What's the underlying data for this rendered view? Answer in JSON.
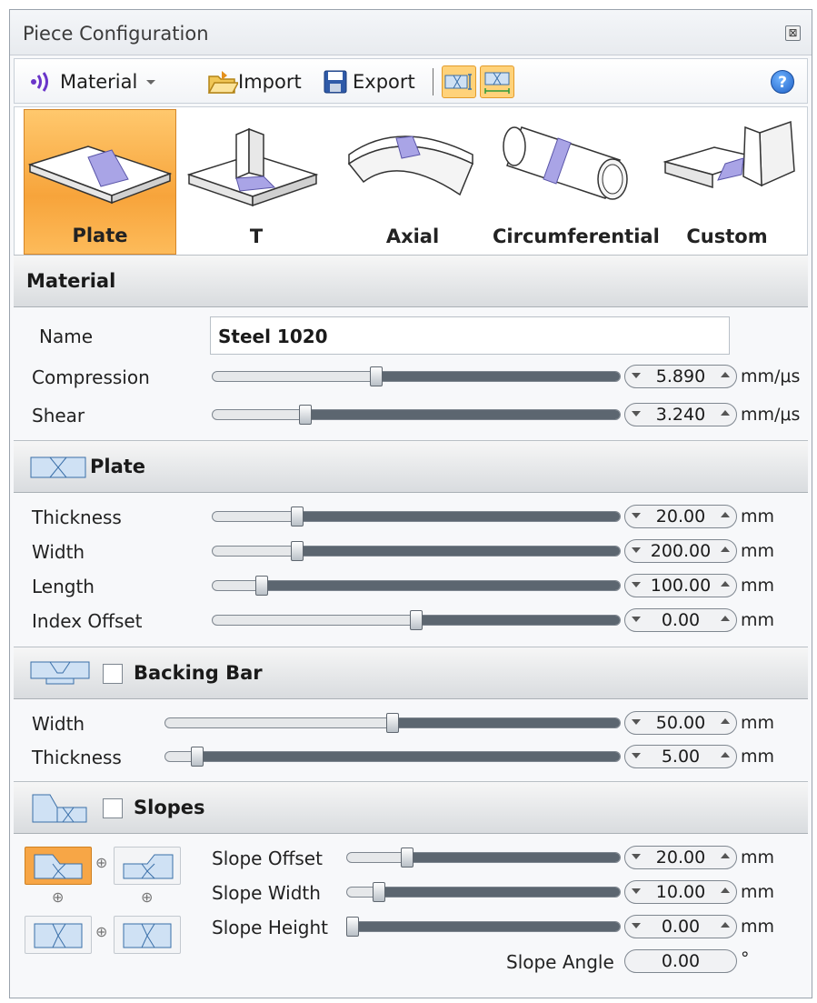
{
  "window": {
    "title": "Piece Configuration",
    "close_glyph": "⊠"
  },
  "toolbar": {
    "material_label": "Material",
    "import_label": "Import",
    "export_label": "Export",
    "help_glyph": "?"
  },
  "piece_types": [
    {
      "label": "Plate",
      "selected": true
    },
    {
      "label": "T",
      "selected": false
    },
    {
      "label": "Axial",
      "selected": false
    },
    {
      "label": "Circumferential",
      "selected": false
    },
    {
      "label": "Custom",
      "selected": false
    }
  ],
  "material": {
    "title": "Material",
    "name_label": "Name",
    "name_value": "Steel 1020",
    "compression": {
      "label": "Compression",
      "value": "5.890",
      "unit": "mm/μs",
      "level": 0.4
    },
    "shear": {
      "label": "Shear",
      "value": "3.240",
      "unit": "mm/μs",
      "level": 0.22
    }
  },
  "plate": {
    "title": "Plate",
    "thickness": {
      "label": "Thickness",
      "value": "20.00",
      "unit": "mm",
      "level": 0.2
    },
    "width": {
      "label": "Width",
      "value": "200.00",
      "unit": "mm",
      "level": 0.2
    },
    "length": {
      "label": "Length",
      "value": "100.00",
      "unit": "mm",
      "level": 0.11
    },
    "index_offset": {
      "label": "Index Offset",
      "value": "0.00",
      "unit": "mm",
      "level": 0.5
    }
  },
  "backing_bar": {
    "title": "Backing Bar",
    "checked": false,
    "width": {
      "label": "Width",
      "value": "50.00",
      "unit": "mm",
      "level": 0.5
    },
    "thickness": {
      "label": "Thickness",
      "value": "5.00",
      "unit": "mm",
      "level": 0.06
    }
  },
  "slopes": {
    "title": "Slopes",
    "checked": false,
    "slope_offset": {
      "label": "Slope Offset",
      "value": "20.00",
      "unit": "mm",
      "level": 0.21
    },
    "slope_width": {
      "label": "Slope Width",
      "value": "10.00",
      "unit": "mm",
      "level": 0.1
    },
    "slope_height": {
      "label": "Slope Height",
      "value": "0.00",
      "unit": "mm",
      "level": 0.0
    },
    "slope_angle": {
      "label": "Slope Angle",
      "value": "0.00",
      "unit": "°"
    }
  },
  "colors": {
    "accent_orange": "#f7a43b",
    "weld_purple": "#a9a4e6",
    "slider_fill": "#5c6670"
  }
}
